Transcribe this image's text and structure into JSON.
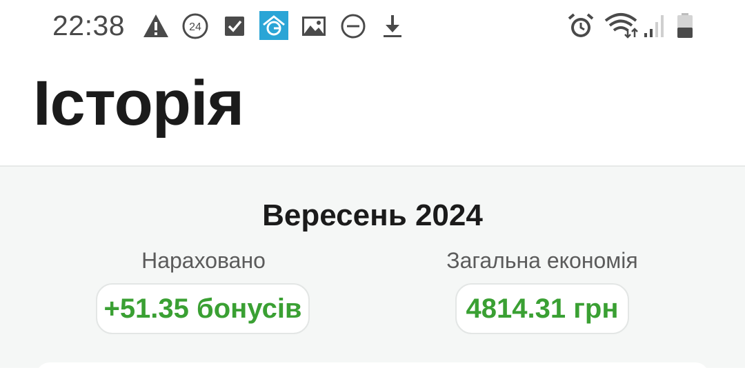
{
  "status_bar": {
    "time": "22:38",
    "badge_number": "24",
    "icons_left": [
      "warning-icon",
      "badge-24-icon",
      "checkbox-icon",
      "app-g-icon",
      "image-icon",
      "do-not-disturb-icon",
      "download-icon"
    ],
    "icons_right": [
      "alarm-icon",
      "wifi-icon",
      "signal-icon",
      "battery-icon"
    ]
  },
  "header": {
    "title": "Історія"
  },
  "summary": {
    "month": "Вересень 2024",
    "accrued_label": "Нараховано",
    "accrued_value": "+51.35 бонусів",
    "savings_label": "Загальна економія",
    "savings_value": "4814.31 грн"
  },
  "colors": {
    "accent_green": "#3aa033",
    "background": "#f5f7f6",
    "text": "#1b1b1b"
  }
}
